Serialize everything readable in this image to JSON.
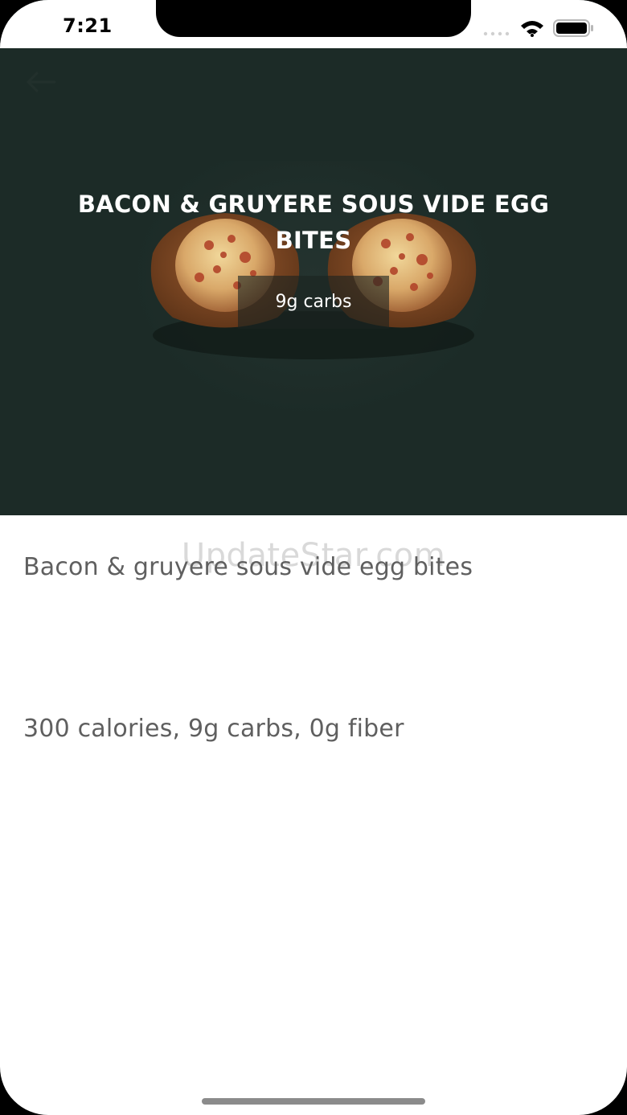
{
  "status_bar": {
    "time": "7:21",
    "icons": [
      "signal-icon",
      "wifi-icon",
      "battery-icon"
    ]
  },
  "hero": {
    "title": "BACON & GRUYERE SOUS VIDE EGG BITES",
    "badge": "9g carbs",
    "background_color": "#1c2b27",
    "image": "egg-bites-photo"
  },
  "watermark": "UpdateStar.com",
  "detail": {
    "name": "Bacon & gruyere sous vide egg bites",
    "nutrition": "300 calories, 9g carbs, 0g fiber"
  },
  "colors": {
    "text_secondary": "#5f5f5f",
    "hero_background": "#1c2b27"
  }
}
